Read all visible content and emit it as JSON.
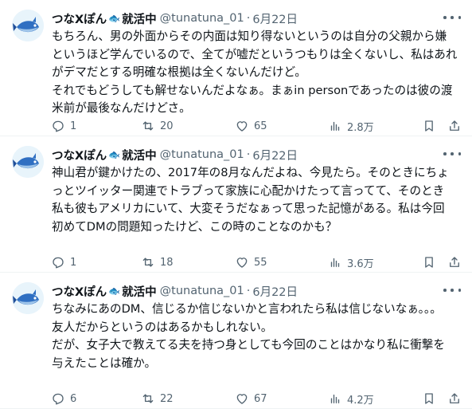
{
  "tweets": [
    {
      "author": "つなXぽん",
      "badge": "🐟",
      "status": "就活中",
      "handle": "@tunatuna_01",
      "date": "6月22日",
      "lines": [
        "もちろん、男の外面からその内面は知り得ないというのは自分の父親から嫌",
        "というほど学んでいるので、全てが嘘だというつもりは全くないし、私はあれ",
        "がデマだとする明確な根拠は全くないんだけど。",
        "それでもどうしても解せないんだよなぁ。まぁin personであったのは彼の渡",
        "米前が最後なんだけどさ。"
      ],
      "replies": "1",
      "retweets": "20",
      "likes": "65",
      "views": "2.8万"
    },
    {
      "author": "つなXぽん",
      "badge": "🐟",
      "status": "就活中",
      "handle": "@tunatuna_01",
      "date": "6月22日",
      "lines": [
        "神山君が鍵かけたの、2017年の8月なんだよね、今見たら。そのときにちょ",
        "っとツイッター関連でトラブって家族に心配かけたって言ってて、そのとき",
        "私も彼もアメリカにいて、大変そうだなぁって思った記憶がある。私は今回",
        "初めてDMの問題知ったけど、この時のことなのかも？"
      ],
      "replies": "1",
      "retweets": "18",
      "likes": "55",
      "views": "3.6万"
    },
    {
      "author": "つなXぽん",
      "badge": "🐟",
      "status": "就活中",
      "handle": "@tunatuna_01",
      "date": "6月22日",
      "lines": [
        "ちなみにあのDM、信じるか信じないかと言われたら私は信じないなぁ。。。",
        "友人だからというのはあるかもしれない。",
        "だが、女子大で教えてる夫を持つ身としても今回のことはかなり私に衝撃を",
        "与えたことは確か。"
      ],
      "replies": "6",
      "retweets": "22",
      "likes": "67",
      "views": "4.2万"
    }
  ]
}
